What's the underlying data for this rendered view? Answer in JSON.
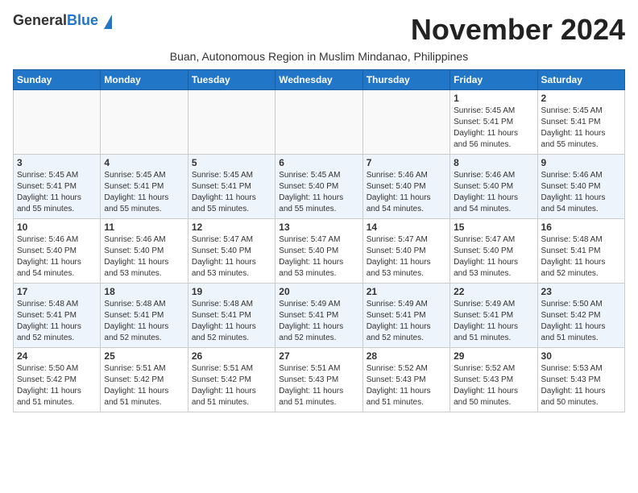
{
  "header": {
    "logo_general": "General",
    "logo_blue": "Blue",
    "month_title": "November 2024",
    "subtitle": "Buan, Autonomous Region in Muslim Mindanao, Philippines"
  },
  "weekdays": [
    "Sunday",
    "Monday",
    "Tuesday",
    "Wednesday",
    "Thursday",
    "Friday",
    "Saturday"
  ],
  "weeks": [
    [
      {
        "day": "",
        "info": ""
      },
      {
        "day": "",
        "info": ""
      },
      {
        "day": "",
        "info": ""
      },
      {
        "day": "",
        "info": ""
      },
      {
        "day": "",
        "info": ""
      },
      {
        "day": "1",
        "info": "Sunrise: 5:45 AM\nSunset: 5:41 PM\nDaylight: 11 hours\nand 56 minutes."
      },
      {
        "day": "2",
        "info": "Sunrise: 5:45 AM\nSunset: 5:41 PM\nDaylight: 11 hours\nand 55 minutes."
      }
    ],
    [
      {
        "day": "3",
        "info": "Sunrise: 5:45 AM\nSunset: 5:41 PM\nDaylight: 11 hours\nand 55 minutes."
      },
      {
        "day": "4",
        "info": "Sunrise: 5:45 AM\nSunset: 5:41 PM\nDaylight: 11 hours\nand 55 minutes."
      },
      {
        "day": "5",
        "info": "Sunrise: 5:45 AM\nSunset: 5:41 PM\nDaylight: 11 hours\nand 55 minutes."
      },
      {
        "day": "6",
        "info": "Sunrise: 5:45 AM\nSunset: 5:40 PM\nDaylight: 11 hours\nand 55 minutes."
      },
      {
        "day": "7",
        "info": "Sunrise: 5:46 AM\nSunset: 5:40 PM\nDaylight: 11 hours\nand 54 minutes."
      },
      {
        "day": "8",
        "info": "Sunrise: 5:46 AM\nSunset: 5:40 PM\nDaylight: 11 hours\nand 54 minutes."
      },
      {
        "day": "9",
        "info": "Sunrise: 5:46 AM\nSunset: 5:40 PM\nDaylight: 11 hours\nand 54 minutes."
      }
    ],
    [
      {
        "day": "10",
        "info": "Sunrise: 5:46 AM\nSunset: 5:40 PM\nDaylight: 11 hours\nand 54 minutes."
      },
      {
        "day": "11",
        "info": "Sunrise: 5:46 AM\nSunset: 5:40 PM\nDaylight: 11 hours\nand 53 minutes."
      },
      {
        "day": "12",
        "info": "Sunrise: 5:47 AM\nSunset: 5:40 PM\nDaylight: 11 hours\nand 53 minutes."
      },
      {
        "day": "13",
        "info": "Sunrise: 5:47 AM\nSunset: 5:40 PM\nDaylight: 11 hours\nand 53 minutes."
      },
      {
        "day": "14",
        "info": "Sunrise: 5:47 AM\nSunset: 5:40 PM\nDaylight: 11 hours\nand 53 minutes."
      },
      {
        "day": "15",
        "info": "Sunrise: 5:47 AM\nSunset: 5:40 PM\nDaylight: 11 hours\nand 53 minutes."
      },
      {
        "day": "16",
        "info": "Sunrise: 5:48 AM\nSunset: 5:41 PM\nDaylight: 11 hours\nand 52 minutes."
      }
    ],
    [
      {
        "day": "17",
        "info": "Sunrise: 5:48 AM\nSunset: 5:41 PM\nDaylight: 11 hours\nand 52 minutes."
      },
      {
        "day": "18",
        "info": "Sunrise: 5:48 AM\nSunset: 5:41 PM\nDaylight: 11 hours\nand 52 minutes."
      },
      {
        "day": "19",
        "info": "Sunrise: 5:48 AM\nSunset: 5:41 PM\nDaylight: 11 hours\nand 52 minutes."
      },
      {
        "day": "20",
        "info": "Sunrise: 5:49 AM\nSunset: 5:41 PM\nDaylight: 11 hours\nand 52 minutes."
      },
      {
        "day": "21",
        "info": "Sunrise: 5:49 AM\nSunset: 5:41 PM\nDaylight: 11 hours\nand 52 minutes."
      },
      {
        "day": "22",
        "info": "Sunrise: 5:49 AM\nSunset: 5:41 PM\nDaylight: 11 hours\nand 51 minutes."
      },
      {
        "day": "23",
        "info": "Sunrise: 5:50 AM\nSunset: 5:42 PM\nDaylight: 11 hours\nand 51 minutes."
      }
    ],
    [
      {
        "day": "24",
        "info": "Sunrise: 5:50 AM\nSunset: 5:42 PM\nDaylight: 11 hours\nand 51 minutes."
      },
      {
        "day": "25",
        "info": "Sunrise: 5:51 AM\nSunset: 5:42 PM\nDaylight: 11 hours\nand 51 minutes."
      },
      {
        "day": "26",
        "info": "Sunrise: 5:51 AM\nSunset: 5:42 PM\nDaylight: 11 hours\nand 51 minutes."
      },
      {
        "day": "27",
        "info": "Sunrise: 5:51 AM\nSunset: 5:43 PM\nDaylight: 11 hours\nand 51 minutes."
      },
      {
        "day": "28",
        "info": "Sunrise: 5:52 AM\nSunset: 5:43 PM\nDaylight: 11 hours\nand 51 minutes."
      },
      {
        "day": "29",
        "info": "Sunrise: 5:52 AM\nSunset: 5:43 PM\nDaylight: 11 hours\nand 50 minutes."
      },
      {
        "day": "30",
        "info": "Sunrise: 5:53 AM\nSunset: 5:43 PM\nDaylight: 11 hours\nand 50 minutes."
      }
    ]
  ]
}
